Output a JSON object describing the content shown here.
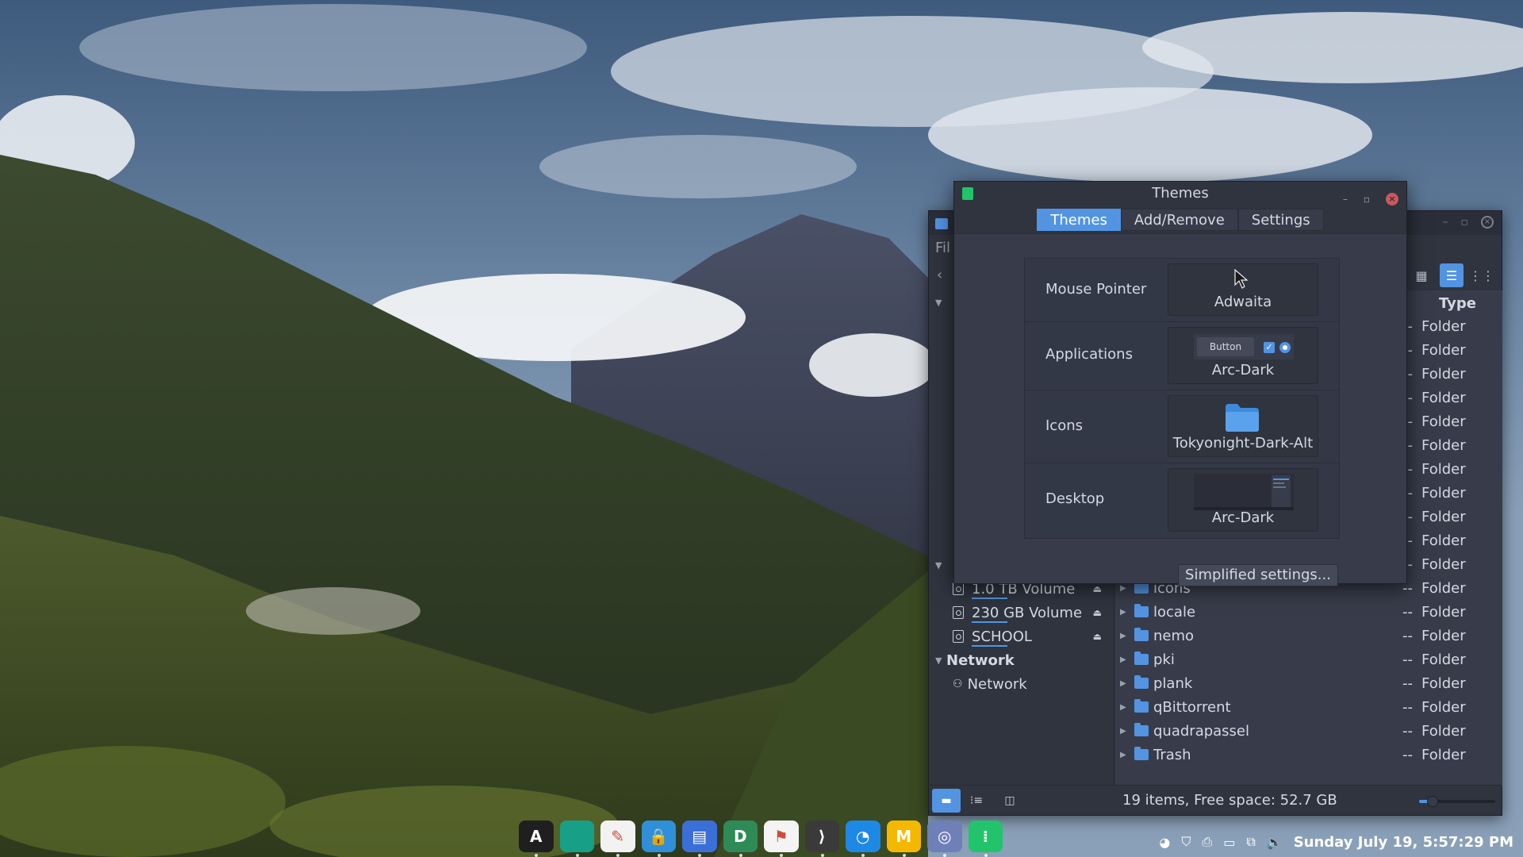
{
  "themes_window": {
    "title": "Themes",
    "tabs": [
      {
        "label": "Themes",
        "active": true
      },
      {
        "label": "Add/Remove",
        "active": false
      },
      {
        "label": "Settings",
        "active": false
      }
    ],
    "rows": [
      {
        "label": "Mouse Pointer",
        "value": "Adwaita"
      },
      {
        "label": "Applications",
        "value": "Arc-Dark",
        "preview_button_label": "Button"
      },
      {
        "label": "Icons",
        "value": "Tokyonight-Dark-Alt"
      },
      {
        "label": "Desktop",
        "value": "Arc-Dark"
      }
    ],
    "simplified_settings_label": "Simplified settings..."
  },
  "file_manager": {
    "menu_fragment": "Fil",
    "type_header": "Type",
    "sidebar": {
      "devices": [
        {
          "label": "1.0 TB Volume"
        },
        {
          "label": "230 GB Volume"
        },
        {
          "label": "SCHOOL"
        }
      ],
      "network_header": "Network",
      "network_items": [
        {
          "label": "Network"
        }
      ]
    },
    "hidden_rows_type": [
      "Folder",
      "Folder",
      "Folder",
      "Folder",
      "Folder",
      "Folder",
      "Folder",
      "Folder",
      "Folder",
      "Folder",
      "Folder"
    ],
    "files": [
      {
        "name": "icons",
        "size": "--",
        "type": "Folder"
      },
      {
        "name": "locale",
        "size": "--",
        "type": "Folder"
      },
      {
        "name": "nemo",
        "size": "--",
        "type": "Folder"
      },
      {
        "name": "pki",
        "size": "--",
        "type": "Folder"
      },
      {
        "name": "plank",
        "size": "--",
        "type": "Folder"
      },
      {
        "name": "qBittorrent",
        "size": "--",
        "type": "Folder"
      },
      {
        "name": "quadrapassel",
        "size": "--",
        "type": "Folder"
      },
      {
        "name": "Trash",
        "size": "--",
        "type": "Folder"
      }
    ],
    "status_text": "19 items, Free space: 52.7 GB",
    "zoom_level": 0.18
  },
  "dock_apps": [
    {
      "icon": "arch-launcher-icon",
      "glyph": "A",
      "color": "#1f1f1f"
    },
    {
      "icon": "file-manager-icon",
      "glyph": "",
      "color": "#17a087"
    },
    {
      "icon": "text-editor-icon",
      "glyph": "✎",
      "color": "#f2f2f2"
    },
    {
      "icon": "password-manager-icon",
      "glyph": "🔒",
      "color": "#2f8fd8"
    },
    {
      "icon": "document-viewer-icon",
      "glyph": "▤",
      "color": "#3b6fd8"
    },
    {
      "icon": "spreadsheet-icon",
      "glyph": "D",
      "color": "#2e8b57"
    },
    {
      "icon": "flag-app-icon",
      "glyph": "⚑",
      "color": "#f4f4f4"
    },
    {
      "icon": "terminal-icon",
      "glyph": "⟩",
      "color": "#3a3a3a"
    },
    {
      "icon": "browser-compass-icon",
      "glyph": "◔",
      "color": "#1e88e5"
    },
    {
      "icon": "mail-icon",
      "glyph": "M",
      "color": "#f5b800"
    },
    {
      "icon": "chromium-icon",
      "glyph": "◎",
      "color": "#6f7fb8"
    },
    {
      "icon": "themes-app-icon",
      "glyph": "⁞",
      "color": "#21c46a"
    }
  ],
  "tray": {
    "clock": "Sunday July 19, 5:57:29 PM"
  },
  "colors": {
    "accent": "#5294e2",
    "close": "#cc575d"
  }
}
